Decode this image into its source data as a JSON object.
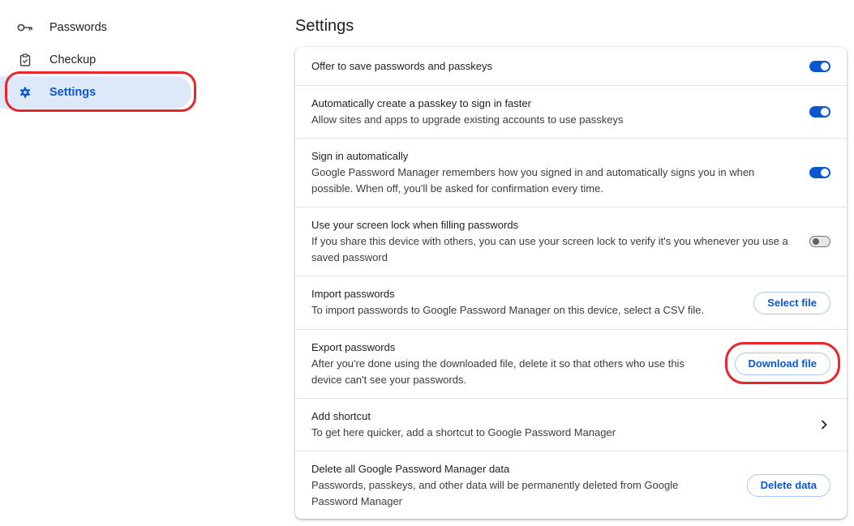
{
  "sidebar": {
    "items": [
      {
        "label": "Passwords",
        "icon": "key-icon"
      },
      {
        "label": "Checkup",
        "icon": "clipboard-check-icon"
      },
      {
        "label": "Settings",
        "icon": "gear-icon",
        "active": true
      }
    ]
  },
  "main": {
    "title": "Settings",
    "rows": [
      {
        "title": "Offer to save passwords and passkeys",
        "control": "toggle",
        "on": true
      },
      {
        "title": "Automatically create a passkey to sign in faster",
        "subtitle": "Allow sites and apps to upgrade existing accounts to use passkeys",
        "control": "toggle",
        "on": true
      },
      {
        "title": "Sign in automatically",
        "subtitle": "Google Password Manager remembers how you signed in and automatically signs you in when possible. When off, you'll be asked for confirmation every time.",
        "control": "toggle",
        "on": true
      },
      {
        "title": "Use your screen lock when filling passwords",
        "subtitle": "If you share this device with others, you can use your screen lock to verify it's you whenever you use a saved password",
        "control": "toggle",
        "on": false
      },
      {
        "title": "Import passwords",
        "subtitle": "To import passwords to Google Password Manager on this device, select a CSV file.",
        "control": "button",
        "button_label": "Select file"
      },
      {
        "title": "Export passwords",
        "subtitle": "After you're done using the downloaded file, delete it so that others who use this device can't see your passwords.",
        "control": "button",
        "button_label": "Download file"
      },
      {
        "title": "Add shortcut",
        "subtitle": "To get here quicker, add a shortcut to Google Password Manager",
        "control": "chevron"
      },
      {
        "title": "Delete all Google Password Manager data",
        "subtitle": "Passwords, passkeys, and other data will be permanently deleted from Google Password Manager",
        "control": "button",
        "button_label": "Delete data"
      }
    ]
  },
  "colors": {
    "accent": "#0b57d0",
    "active_nav_bg": "#dde8f8",
    "annotation": "#e8262b"
  }
}
